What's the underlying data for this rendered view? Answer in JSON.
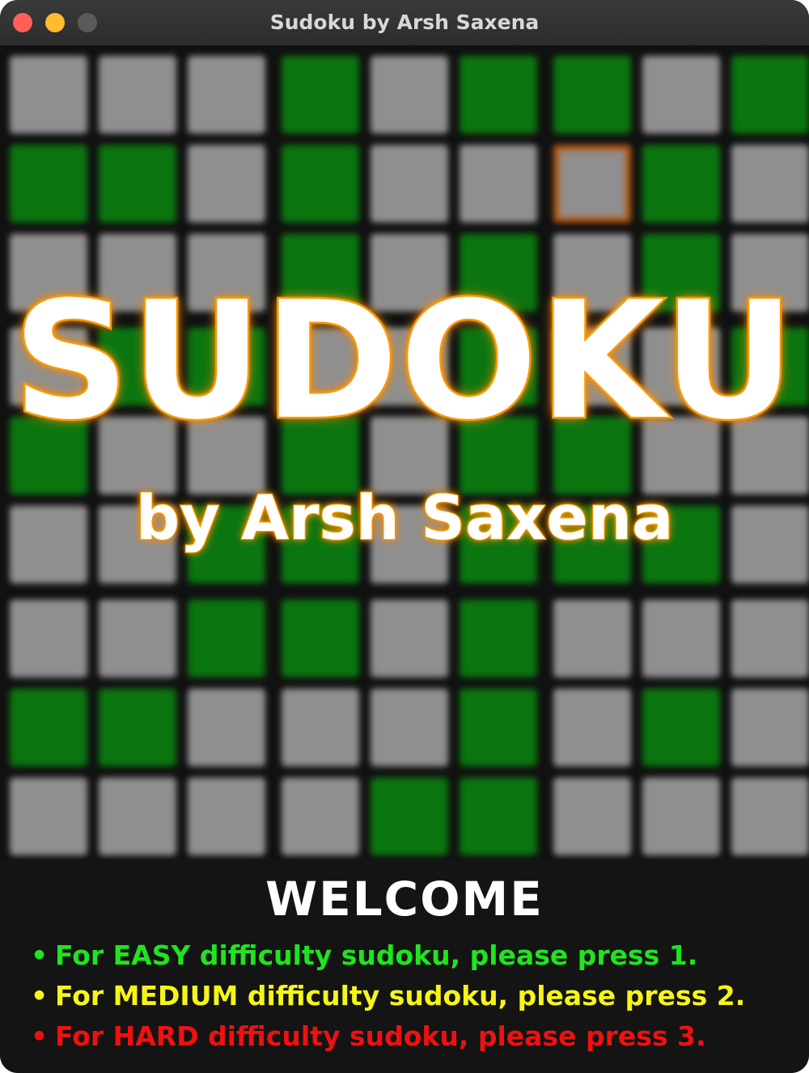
{
  "window": {
    "title": "Sudoku by Arsh Saxena"
  },
  "splash": {
    "heading": "SUDOKU",
    "subheading": "by Arsh Saxena"
  },
  "board": {
    "rows": [
      "GGGRGRRGR",
      "RRGRGGSRG",
      "GGGRGRGRG",
      "GRRGGRGGR",
      "RGGRGRRGG",
      "GGRRGRRRG",
      "GGRRGRGGG",
      "RRGGGRGRG",
      "GGGGRRGGG"
    ],
    "colors": {
      "given": "#8f8f8f",
      "highlight": "#0b7510",
      "selected": "#b85a10"
    }
  },
  "menu": {
    "title": "WELCOME",
    "bullet": "•",
    "options": [
      {
        "text": "For EASY difficulty sudoku, please press 1.",
        "color": "#1fe41f"
      },
      {
        "text": "For MEDIUM difficulty sudoku, please press 2.",
        "color": "#f5f51a"
      },
      {
        "text": "For HARD difficulty sudoku, please press 3.",
        "color": "#ee1111"
      }
    ]
  }
}
